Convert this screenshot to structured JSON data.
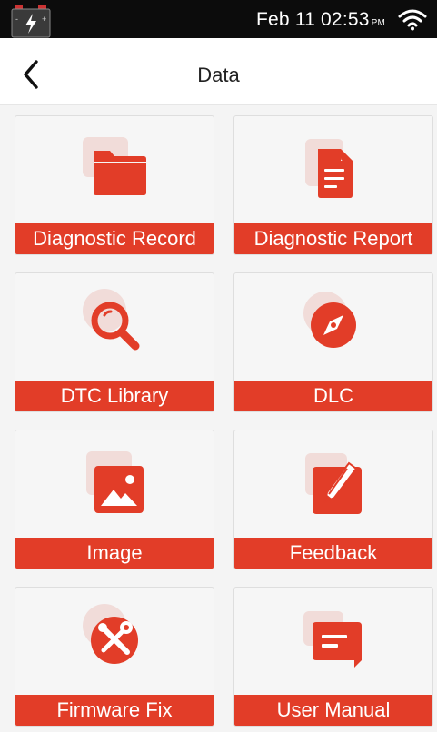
{
  "status_bar": {
    "time": "Feb 11 02:53",
    "ampm": "PM",
    "battery_icon": "battery-charging-icon",
    "wifi_icon": "wifi-icon"
  },
  "header": {
    "title": "Data",
    "back_icon": "chevron-left-icon"
  },
  "colors": {
    "accent": "#e23d28",
    "tile_background": "#f6f6f6",
    "status_bar": "#0c0c0c"
  },
  "tiles": [
    {
      "label": "Diagnostic Record",
      "icon": "folder-icon"
    },
    {
      "label": "Diagnostic Report",
      "icon": "document-icon"
    },
    {
      "label": "DTC Library",
      "icon": "magnifier-icon"
    },
    {
      "label": "DLC",
      "icon": "compass-icon"
    },
    {
      "label": "Image",
      "icon": "image-icon"
    },
    {
      "label": "Feedback",
      "icon": "edit-pencil-icon"
    },
    {
      "label": "Firmware Fix",
      "icon": "tools-icon"
    },
    {
      "label": "User Manual",
      "icon": "chat-bubble-icon"
    }
  ]
}
